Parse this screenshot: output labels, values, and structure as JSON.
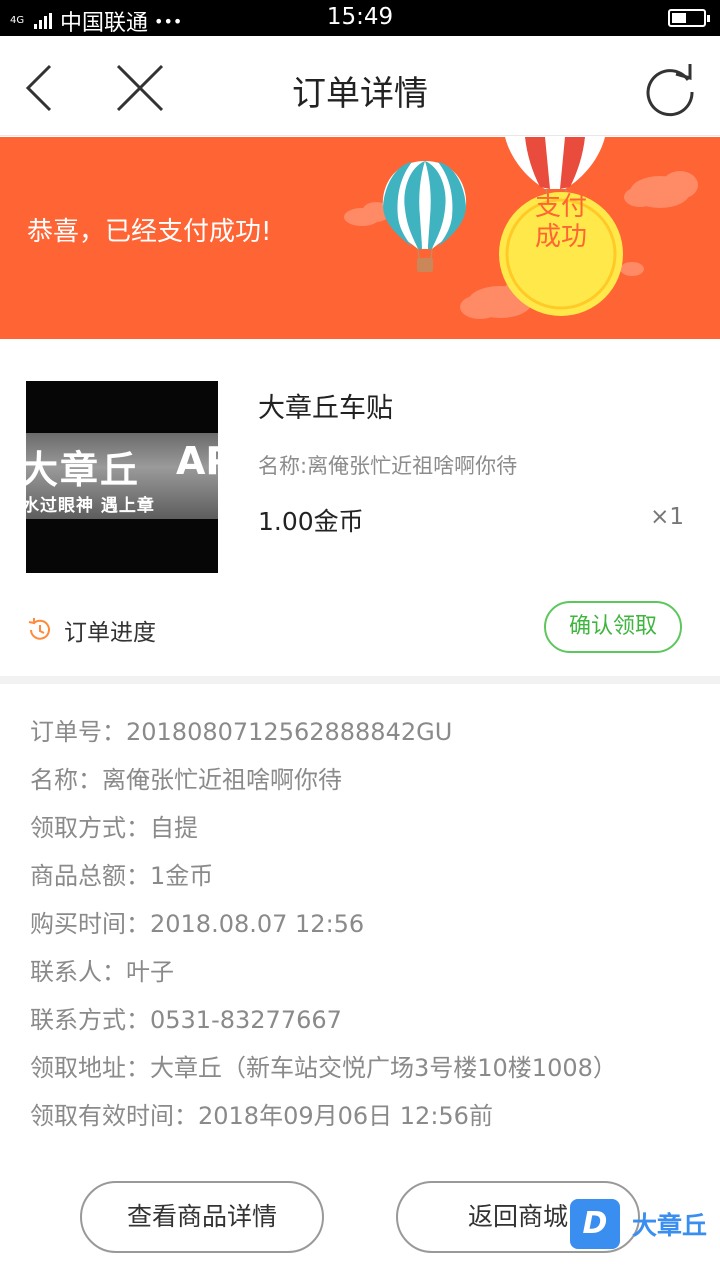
{
  "status_bar": {
    "carrier": "中国联通",
    "dots": "•••",
    "network": "4G",
    "time": "15:49"
  },
  "nav": {
    "title": "订单详情"
  },
  "banner": {
    "message": "恭喜，已经支付成功!",
    "badge_line1": "支付",
    "badge_line2": "成功"
  },
  "product": {
    "name": "大章丘车贴",
    "subtitle": "名称:离俺张忙近祖啥啊你待",
    "price": "1.00金币",
    "quantity": "×1",
    "image": {
      "text_main": "大章丘",
      "text_side": "AP",
      "text_sub": "水过眼神  遇上章"
    },
    "progress_label": "订单进度",
    "confirm_label": "确认领取"
  },
  "details": [
    "订单号：2018080712562888842GU",
    "名称：离俺张忙近祖啥啊你待",
    "领取方式：自提",
    "商品总额：1金币",
    "购买时间：2018.08.07 12:56",
    "联系人：叶子",
    "联系方式：0531-83277667",
    "领取地址：大章丘（新车站交悦广场3号楼10楼1008）",
    "领取有效时间：2018年09月06日 12:56前"
  ],
  "buttons": {
    "view_detail": "查看商品详情",
    "back_mall": "返回商城"
  },
  "watermark": {
    "logo": "D",
    "text": "大章丘"
  },
  "colors": {
    "banner": "#ff6434",
    "confirm": "#5cc75c",
    "badge": "#ffe94a"
  }
}
